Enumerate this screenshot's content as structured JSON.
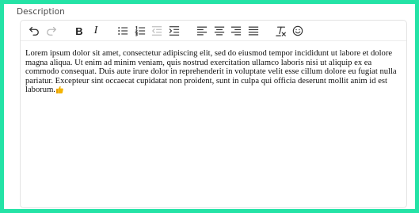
{
  "field": {
    "label": "Description"
  },
  "toolbar": {
    "buttons": [
      {
        "name": "undo-icon"
      },
      {
        "name": "redo-icon"
      },
      {
        "name": "bold-icon",
        "label": "B"
      },
      {
        "name": "italic-icon",
        "label": "I"
      },
      {
        "name": "bullet-list-icon"
      },
      {
        "name": "numbered-list-icon"
      },
      {
        "name": "outdent-icon"
      },
      {
        "name": "indent-icon"
      },
      {
        "name": "align-left-icon"
      },
      {
        "name": "align-center-icon"
      },
      {
        "name": "align-right-icon"
      },
      {
        "name": "align-justify-icon"
      },
      {
        "name": "clear-formatting-icon"
      },
      {
        "name": "emoji-icon"
      }
    ]
  },
  "editor": {
    "content": "Lorem ipsum dolor sit amet, consectetur adipiscing elit, sed do eiusmod tempor incididunt ut labore et dolore magna aliqua. Ut enim ad minim veniam, quis nostrud exercitation ullamco laboris nisi ut aliquip ex ea commodo consequat. Duis aute irure dolor in reprehenderit in voluptate velit esse cillum dolore eu fugiat nulla pariatur. Excepteur sint occaecat cupidatat non proident, sunt in culpa qui officia deserunt mollit anim id est laborum.",
    "trailing_emoji": "thumbs-up-icon"
  },
  "colors": {
    "frame_border": "#24e3a6",
    "editor_border": "#e3e3e3",
    "emoji": "#f4b400"
  }
}
